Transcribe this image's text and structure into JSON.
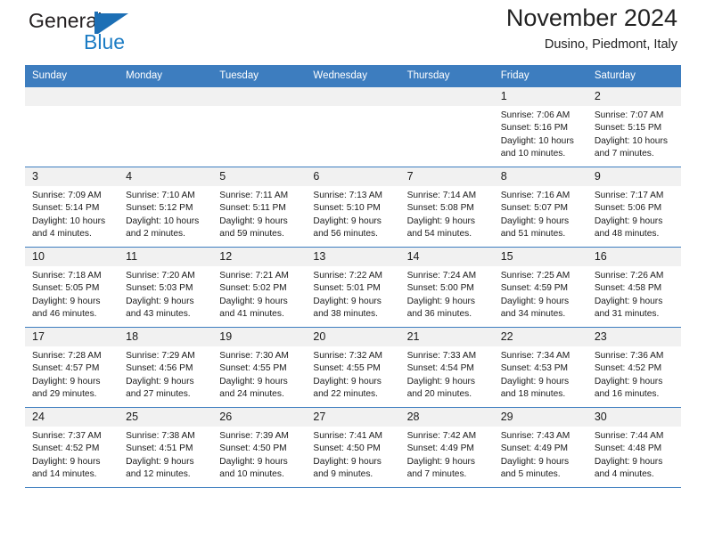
{
  "brand": {
    "name_top": "General",
    "name_bottom": "Blue",
    "mark": "blue-triangle-logo"
  },
  "header": {
    "title": "November 2024",
    "subtitle": "Dusino, Piedmont, Italy"
  },
  "colors": {
    "header_blue": "#3d7dbf",
    "daynum_band": "#f1f1f1",
    "brand_blue": "#1c7cc4",
    "text": "#1a1a1a"
  },
  "labels": {
    "sunrise_prefix": "Sunrise:",
    "sunset_prefix": "Sunset:",
    "daylight_prefix": "Daylight:"
  },
  "weekdays": [
    "Sunday",
    "Monday",
    "Tuesday",
    "Wednesday",
    "Thursday",
    "Friday",
    "Saturday"
  ],
  "weeks": [
    [
      {
        "day": "",
        "empty": true
      },
      {
        "day": "",
        "empty": true
      },
      {
        "day": "",
        "empty": true
      },
      {
        "day": "",
        "empty": true
      },
      {
        "day": "",
        "empty": true
      },
      {
        "day": "1",
        "sunrise": "Sunrise: 7:06 AM",
        "sunset": "Sunset: 5:16 PM",
        "daylight": "Daylight: 10 hours and 10 minutes."
      },
      {
        "day": "2",
        "sunrise": "Sunrise: 7:07 AM",
        "sunset": "Sunset: 5:15 PM",
        "daylight": "Daylight: 10 hours and 7 minutes."
      }
    ],
    [
      {
        "day": "3",
        "sunrise": "Sunrise: 7:09 AM",
        "sunset": "Sunset: 5:14 PM",
        "daylight": "Daylight: 10 hours and 4 minutes."
      },
      {
        "day": "4",
        "sunrise": "Sunrise: 7:10 AM",
        "sunset": "Sunset: 5:12 PM",
        "daylight": "Daylight: 10 hours and 2 minutes."
      },
      {
        "day": "5",
        "sunrise": "Sunrise: 7:11 AM",
        "sunset": "Sunset: 5:11 PM",
        "daylight": "Daylight: 9 hours and 59 minutes."
      },
      {
        "day": "6",
        "sunrise": "Sunrise: 7:13 AM",
        "sunset": "Sunset: 5:10 PM",
        "daylight": "Daylight: 9 hours and 56 minutes."
      },
      {
        "day": "7",
        "sunrise": "Sunrise: 7:14 AM",
        "sunset": "Sunset: 5:08 PM",
        "daylight": "Daylight: 9 hours and 54 minutes."
      },
      {
        "day": "8",
        "sunrise": "Sunrise: 7:16 AM",
        "sunset": "Sunset: 5:07 PM",
        "daylight": "Daylight: 9 hours and 51 minutes."
      },
      {
        "day": "9",
        "sunrise": "Sunrise: 7:17 AM",
        "sunset": "Sunset: 5:06 PM",
        "daylight": "Daylight: 9 hours and 48 minutes."
      }
    ],
    [
      {
        "day": "10",
        "sunrise": "Sunrise: 7:18 AM",
        "sunset": "Sunset: 5:05 PM",
        "daylight": "Daylight: 9 hours and 46 minutes."
      },
      {
        "day": "11",
        "sunrise": "Sunrise: 7:20 AM",
        "sunset": "Sunset: 5:03 PM",
        "daylight": "Daylight: 9 hours and 43 minutes."
      },
      {
        "day": "12",
        "sunrise": "Sunrise: 7:21 AM",
        "sunset": "Sunset: 5:02 PM",
        "daylight": "Daylight: 9 hours and 41 minutes."
      },
      {
        "day": "13",
        "sunrise": "Sunrise: 7:22 AM",
        "sunset": "Sunset: 5:01 PM",
        "daylight": "Daylight: 9 hours and 38 minutes."
      },
      {
        "day": "14",
        "sunrise": "Sunrise: 7:24 AM",
        "sunset": "Sunset: 5:00 PM",
        "daylight": "Daylight: 9 hours and 36 minutes."
      },
      {
        "day": "15",
        "sunrise": "Sunrise: 7:25 AM",
        "sunset": "Sunset: 4:59 PM",
        "daylight": "Daylight: 9 hours and 34 minutes."
      },
      {
        "day": "16",
        "sunrise": "Sunrise: 7:26 AM",
        "sunset": "Sunset: 4:58 PM",
        "daylight": "Daylight: 9 hours and 31 minutes."
      }
    ],
    [
      {
        "day": "17",
        "sunrise": "Sunrise: 7:28 AM",
        "sunset": "Sunset: 4:57 PM",
        "daylight": "Daylight: 9 hours and 29 minutes."
      },
      {
        "day": "18",
        "sunrise": "Sunrise: 7:29 AM",
        "sunset": "Sunset: 4:56 PM",
        "daylight": "Daylight: 9 hours and 27 minutes."
      },
      {
        "day": "19",
        "sunrise": "Sunrise: 7:30 AM",
        "sunset": "Sunset: 4:55 PM",
        "daylight": "Daylight: 9 hours and 24 minutes."
      },
      {
        "day": "20",
        "sunrise": "Sunrise: 7:32 AM",
        "sunset": "Sunset: 4:55 PM",
        "daylight": "Daylight: 9 hours and 22 minutes."
      },
      {
        "day": "21",
        "sunrise": "Sunrise: 7:33 AM",
        "sunset": "Sunset: 4:54 PM",
        "daylight": "Daylight: 9 hours and 20 minutes."
      },
      {
        "day": "22",
        "sunrise": "Sunrise: 7:34 AM",
        "sunset": "Sunset: 4:53 PM",
        "daylight": "Daylight: 9 hours and 18 minutes."
      },
      {
        "day": "23",
        "sunrise": "Sunrise: 7:36 AM",
        "sunset": "Sunset: 4:52 PM",
        "daylight": "Daylight: 9 hours and 16 minutes."
      }
    ],
    [
      {
        "day": "24",
        "sunrise": "Sunrise: 7:37 AM",
        "sunset": "Sunset: 4:52 PM",
        "daylight": "Daylight: 9 hours and 14 minutes."
      },
      {
        "day": "25",
        "sunrise": "Sunrise: 7:38 AM",
        "sunset": "Sunset: 4:51 PM",
        "daylight": "Daylight: 9 hours and 12 minutes."
      },
      {
        "day": "26",
        "sunrise": "Sunrise: 7:39 AM",
        "sunset": "Sunset: 4:50 PM",
        "daylight": "Daylight: 9 hours and 10 minutes."
      },
      {
        "day": "27",
        "sunrise": "Sunrise: 7:41 AM",
        "sunset": "Sunset: 4:50 PM",
        "daylight": "Daylight: 9 hours and 9 minutes."
      },
      {
        "day": "28",
        "sunrise": "Sunrise: 7:42 AM",
        "sunset": "Sunset: 4:49 PM",
        "daylight": "Daylight: 9 hours and 7 minutes."
      },
      {
        "day": "29",
        "sunrise": "Sunrise: 7:43 AM",
        "sunset": "Sunset: 4:49 PM",
        "daylight": "Daylight: 9 hours and 5 minutes."
      },
      {
        "day": "30",
        "sunrise": "Sunrise: 7:44 AM",
        "sunset": "Sunset: 4:48 PM",
        "daylight": "Daylight: 9 hours and 4 minutes."
      }
    ]
  ]
}
